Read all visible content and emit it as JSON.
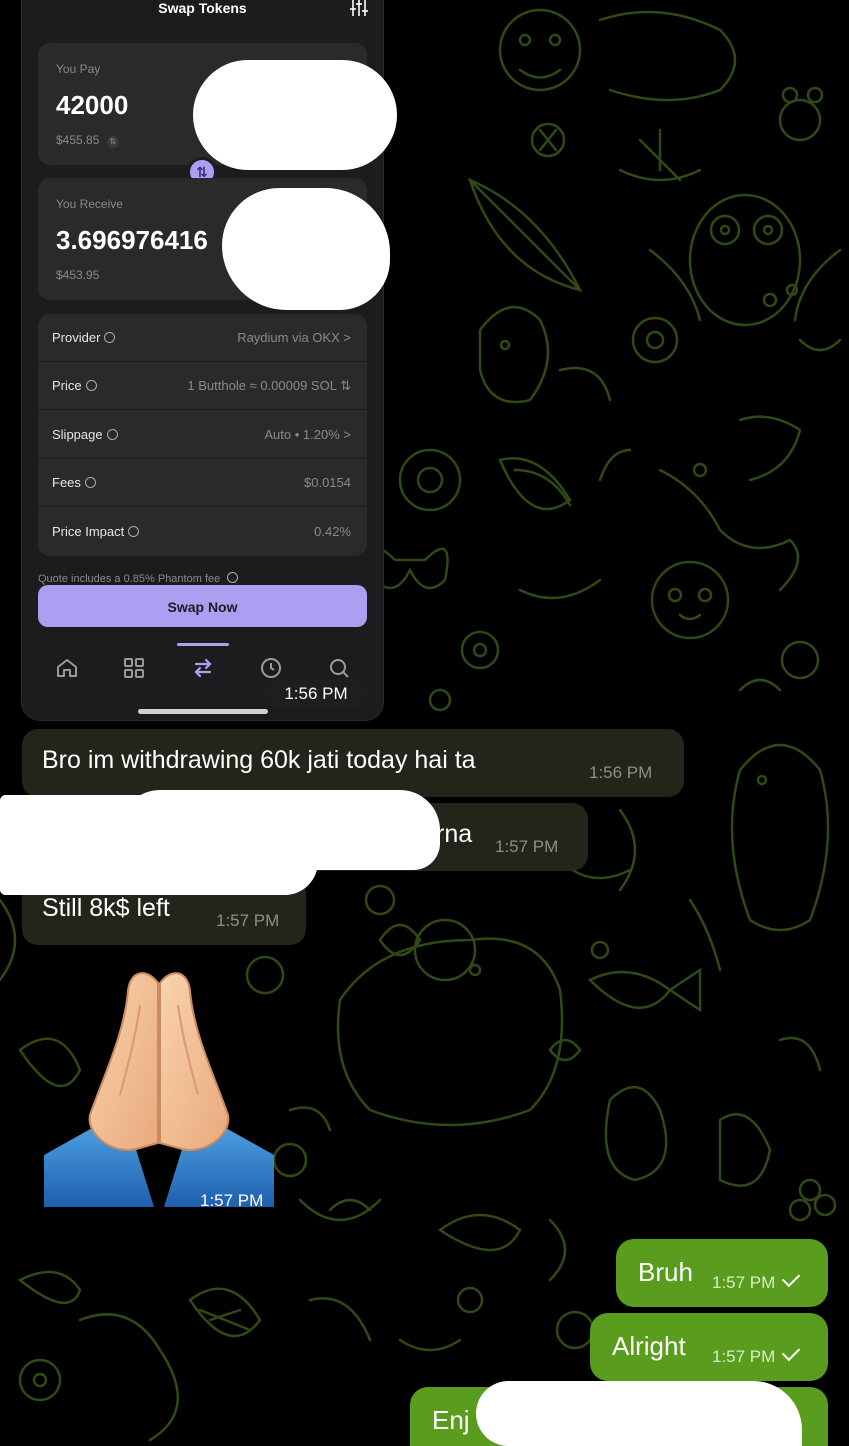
{
  "app": {
    "title": "Swap Tokens",
    "settings_icon": "sliders-icon",
    "accent_color": "#ab9ff2",
    "you_pay": {
      "label": "You Pay",
      "amount": "42000",
      "usd": "$455.85"
    },
    "you_receive": {
      "label": "You Receive",
      "amount": "3.696976416",
      "usd": "$453.95"
    },
    "details": [
      {
        "label": "Provider",
        "value": "Raydium via OKX",
        "suffix": ">"
      },
      {
        "label": "Price",
        "value": "1 Butthole ≈ 0.00009 SOL",
        "suffix": "⇅"
      },
      {
        "label": "Slippage",
        "value": "Auto • 1.20%",
        "suffix": ">"
      },
      {
        "label": "Fees",
        "value": "$0.0154",
        "suffix": ""
      },
      {
        "label": "Price Impact",
        "value": "0.42%",
        "suffix": ""
      }
    ],
    "quote_note": "Quote includes a 0.85% Phantom fee",
    "swap_button": "Swap Now",
    "nav": [
      "home-icon",
      "grid-icon",
      "swap-icon",
      "history-icon",
      "search-icon"
    ]
  },
  "chat": {
    "incoming_color": "#22251a",
    "outgoing_color": "#5a9c1e",
    "screenshot_time": "1:56 PM",
    "messages": [
      {
        "text": "Bro im withdrawing 60k jati today hai ta",
        "time": "1:56 PM"
      },
      {
        "text": "rna",
        "time": "1:57 PM"
      },
      {
        "text": "Still 8k$ left",
        "time": "1:57 PM"
      },
      {
        "text": "🙏",
        "time": "1:57 PM"
      },
      {
        "text": "Bruh",
        "time": "1:57 PM"
      },
      {
        "text": "Alright",
        "time": "1:57 PM"
      },
      {
        "text": "Enj",
        "time": ""
      }
    ]
  }
}
